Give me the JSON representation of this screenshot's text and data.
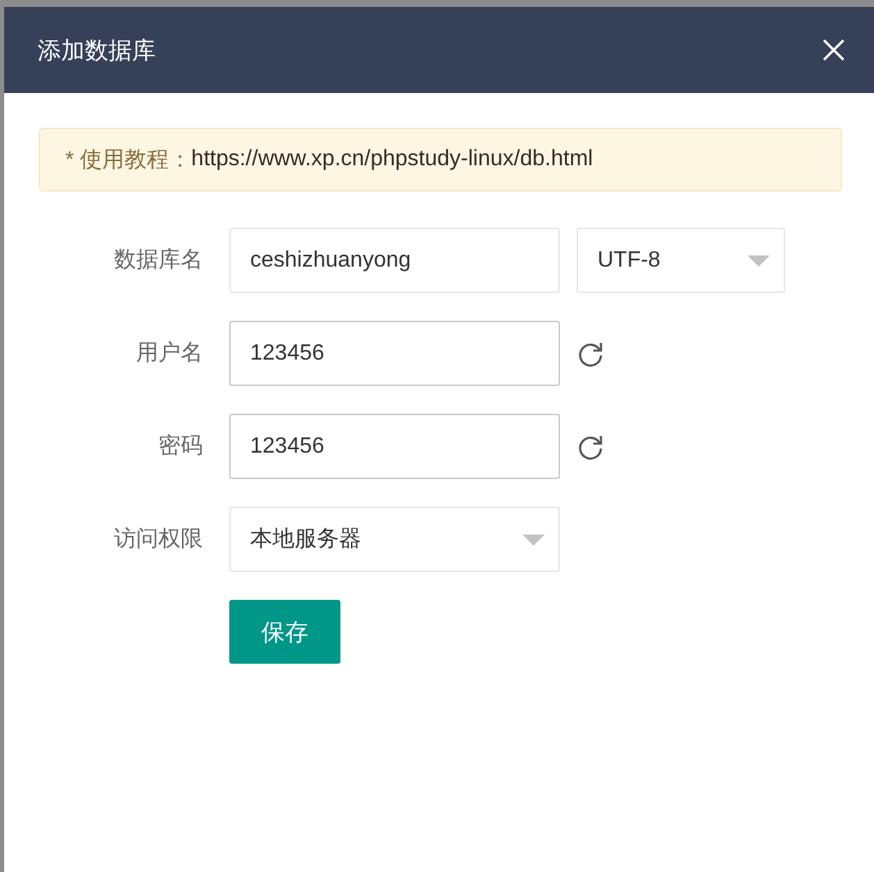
{
  "dialog": {
    "title": "添加数据库"
  },
  "notice": {
    "prefix": "* 使用教程：",
    "url": "https://www.xp.cn/phpstudy-linux/db.html"
  },
  "fields": [
    {
      "label": "数据库名",
      "kind": "input",
      "value": "ceshizhuanyong",
      "addon": {
        "kind": "select",
        "value": "UTF-8"
      }
    },
    {
      "label": "用户名",
      "kind": "input",
      "value": "123456",
      "addon": {
        "kind": "refresh"
      }
    },
    {
      "label": "密码",
      "kind": "input",
      "value": "123456",
      "addon": {
        "kind": "refresh"
      }
    },
    {
      "label": "访问权限",
      "kind": "select",
      "value": "本地服务器"
    }
  ],
  "save_button": "保存"
}
